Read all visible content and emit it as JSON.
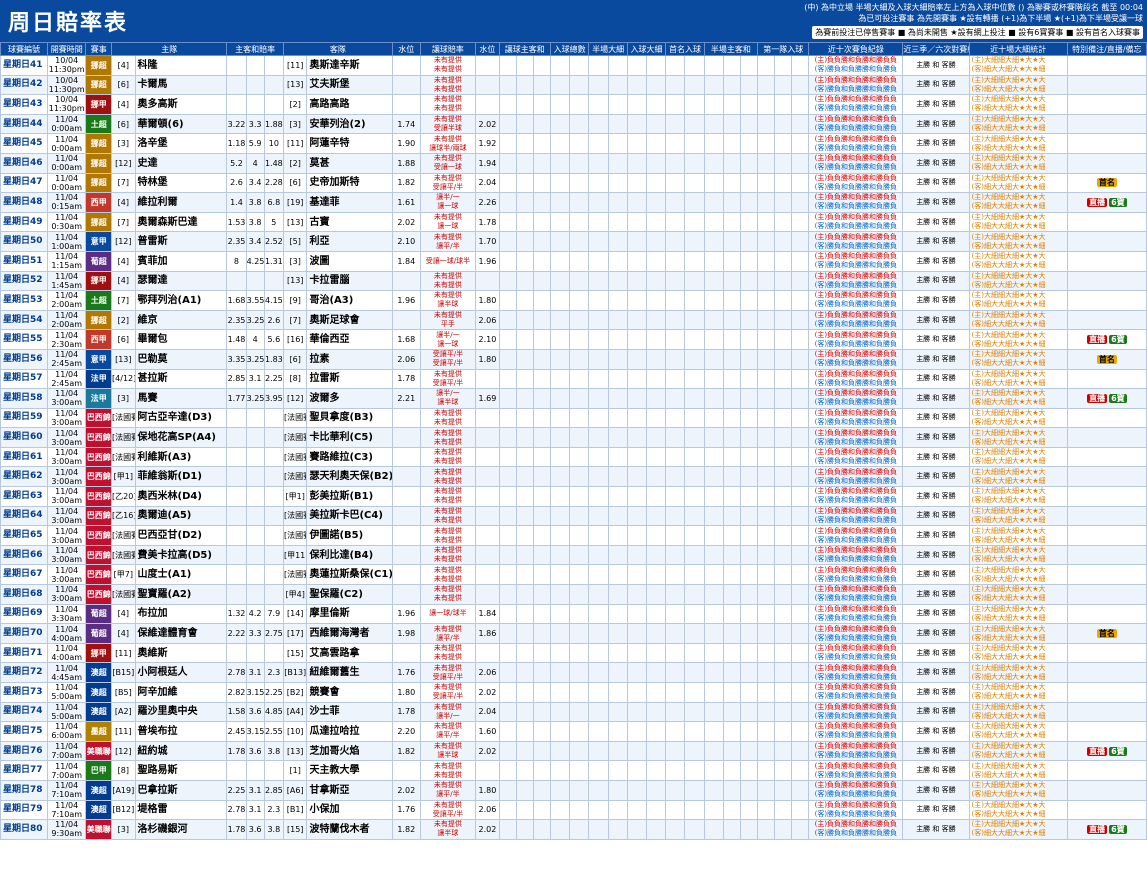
{
  "title": "周日賠率表",
  "legend": {
    "l1": "(中) 為中立場 半場大細及入球大細賠率左上方為入球中位數 () 為聯賽或杯賽階段名 截至 00:04",
    "l2": "為已可投注賽事 為先開賽事 ★設有轉播 (+1)為下半場 ★(+1)為下半場受讓一球",
    "l3": "為賽前投注已停售賽事 ■ 為尚未開售 ★設有網上投注 ■ 設有6寶賽事 ■ 設有首名入球賽事"
  },
  "headers": {
    "match": "球賽編號",
    "time": "開賽時間",
    "league": "賽事",
    "home_rank": "(排名)",
    "home": "主隊",
    "hda": "主客和賠率",
    "h": "主",
    "d": "和",
    "a": "客",
    "away_rank": "(排名)",
    "away": "客隊",
    "line": "水位",
    "hdc": "讓球",
    "hdcodds": "讓球賠率",
    "water": "水位",
    "hhad": "讓球主客和",
    "ttg": "入球總數",
    "hft": "半場大細",
    "ou": "入球大細",
    "fg": "首名入球",
    "hdcwin": "半場主客和",
    "first": "第一隊入球",
    "form": "近十次賽負紀錄",
    "rec": "近三季／六次對賽統計",
    "stars": "近十場大細統計",
    "notes": "特別備注/直播/備忘"
  },
  "rows": [
    {
      "id": "星期日41",
      "date": "10/04",
      "time": "11:30pm",
      "lg": "挪超",
      "lgc": "#b07800",
      "hr": "[4]",
      "home": "科隆",
      "h": "",
      "d": "",
      "a": "",
      "ar": "[11]",
      "away": "奧斯達辛斯",
      "line": "",
      "hdc": "未有提供",
      "hdc2": "未有提供",
      "w": ""
    },
    {
      "id": "星期日42",
      "date": "10/04",
      "time": "11:30pm",
      "lg": "挪超",
      "lgc": "#b07800",
      "hr": "[6]",
      "home": "卡爾馬",
      "h": "",
      "d": "",
      "a": "",
      "ar": "[13]",
      "away": "艾夫斯堡",
      "line": "",
      "hdc": "未有提供",
      "hdc2": "未有提供",
      "w": ""
    },
    {
      "id": "星期日43",
      "date": "10/04",
      "time": "11:30pm",
      "lg": "挪甲",
      "lgc": "#a01010",
      "hr": "[4]",
      "home": "奧多高斯",
      "h": "",
      "d": "",
      "a": "",
      "ar": "[2]",
      "away": "高路高路",
      "line": "",
      "hdc": "未有提供",
      "hdc2": "未有提供",
      "w": ""
    },
    {
      "id": "星期日44",
      "date": "11/04",
      "time": "0:00am",
      "lg": "土超",
      "lgc": "#1a7a1a",
      "hr": "[6]",
      "home": "華爾頓(6)",
      "h": "3.22",
      "d": "3.3",
      "a": "1.88",
      "ar": "[3]",
      "away": "安華列治(2)",
      "line": "1.74",
      "hdc": "未有提供",
      "hdc2": "受讓半球",
      "w": "2.02"
    },
    {
      "id": "星期日45",
      "date": "11/04",
      "time": "0:00am",
      "lg": "挪超",
      "lgc": "#b07800",
      "hr": "[3]",
      "home": "洛辛堡",
      "h": "1.18",
      "d": "5.9",
      "a": "10",
      "ar": "[11]",
      "away": "阿蓮辛特",
      "line": "1.90",
      "hdc": "未有提供",
      "hdc2": "讓球半/兩球",
      "w": "1.92"
    },
    {
      "id": "星期日46",
      "date": "11/04",
      "time": "0:00am",
      "lg": "挪超",
      "lgc": "#b07800",
      "hr": "[12]",
      "home": "史達",
      "h": "5.2",
      "d": "4",
      "a": "1.48",
      "ar": "[2]",
      "away": "莫甚",
      "line": "1.88",
      "hdc": "未有提供",
      "hdc2": "受讓一球",
      "w": "1.94"
    },
    {
      "id": "星期日47",
      "date": "11/04",
      "time": "0:00am",
      "lg": "挪超",
      "lgc": "#b07800",
      "hr": "[7]",
      "home": "特林堡",
      "h": "2.6",
      "d": "3.4",
      "a": "2.28",
      "ar": "[6]",
      "away": "史帝加斯特",
      "line": "1.82",
      "hdc": "未有提供",
      "hdc2": "受讓平/半",
      "w": "2.04"
    },
    {
      "id": "星期日48",
      "date": "11/04",
      "time": "0:15am",
      "lg": "西甲",
      "lgc": "#c0392b",
      "hr": "[4]",
      "home": "維拉利爾",
      "h": "1.4",
      "d": "3.8",
      "a": "6.8",
      "ar": "[19]",
      "away": "基達菲",
      "line": "1.61",
      "hdc": "讓半/一",
      "hdc2": "讓一球",
      "w": "2.26"
    },
    {
      "id": "星期日49",
      "date": "11/04",
      "time": "0:30am",
      "lg": "挪超",
      "lgc": "#b07800",
      "hr": "[7]",
      "home": "奧爾森斯巴達",
      "h": "1.53",
      "d": "3.8",
      "a": "5",
      "ar": "[13]",
      "away": "古寶",
      "line": "2.02",
      "hdc": "未有提供",
      "hdc2": "讓一球",
      "w": "1.78"
    },
    {
      "id": "星期日50",
      "date": "11/04",
      "time": "1:00am",
      "lg": "意甲",
      "lgc": "#0a4a9e",
      "hr": "[12]",
      "home": "普雷斯",
      "h": "2.35",
      "d": "3.4",
      "a": "2.52",
      "ar": "[5]",
      "away": "利亞",
      "line": "2.10",
      "hdc": "未有提供",
      "hdc2": "讓平/半",
      "w": "1.70"
    },
    {
      "id": "星期日51",
      "date": "11/04",
      "time": "1:15am",
      "lg": "葡超",
      "lgc": "#5a2d82",
      "hr": "[4]",
      "home": "賓菲加",
      "h": "8",
      "d": "4.25",
      "a": "1.31",
      "ar": "[3]",
      "away": "波圖",
      "line": "1.84",
      "hdc": "受讓一球/球半",
      "hdc2": "",
      "w": "1.96"
    },
    {
      "id": "星期日52",
      "date": "11/04",
      "time": "1:45am",
      "lg": "挪甲",
      "lgc": "#a01010",
      "hr": "[4]",
      "home": "瑟爾達",
      "h": "",
      "d": "",
      "a": "",
      "ar": "[13]",
      "away": "卡拉雷腦",
      "line": "",
      "hdc": "未有提供",
      "hdc2": "未有提供",
      "w": ""
    },
    {
      "id": "星期日53",
      "date": "11/04",
      "time": "2:00am",
      "lg": "土超",
      "lgc": "#1a7a1a",
      "hr": "[7]",
      "home": "鄂拜列治(A1)",
      "h": "1.68",
      "d": "3.55",
      "a": "4.15",
      "ar": "[9]",
      "away": "哥治(A3)",
      "line": "1.96",
      "hdc": "未有提供",
      "hdc2": "讓半球",
      "w": "1.80"
    },
    {
      "id": "星期日54",
      "date": "11/04",
      "time": "2:00am",
      "lg": "挪超",
      "lgc": "#b07800",
      "hr": "[2]",
      "home": "維京",
      "h": "2.35",
      "d": "3.25",
      "a": "2.6",
      "ar": "[7]",
      "away": "奧斯足球會",
      "line": "",
      "hdc": "未有提供",
      "hdc2": "平手",
      "w": "2.06"
    },
    {
      "id": "星期日55",
      "date": "11/04",
      "time": "2:30am",
      "lg": "西甲",
      "lgc": "#c0392b",
      "hr": "[6]",
      "home": "畢爾包",
      "h": "1.48",
      "d": "4",
      "a": "5.6",
      "ar": "[16]",
      "away": "華倫西亞",
      "line": "1.68",
      "hdc": "讓半/一",
      "hdc2": "讓一球",
      "w": "2.10"
    },
    {
      "id": "星期日56",
      "date": "11/04",
      "time": "2:45am",
      "lg": "意甲",
      "lgc": "#0a4a9e",
      "hr": "[13]",
      "home": "巴勒莫",
      "h": "3.35",
      "d": "3.25",
      "a": "1.83",
      "ar": "[6]",
      "away": "拉素",
      "line": "2.06",
      "hdc": "受讓平/半",
      "hdc2": "受讓平/半",
      "w": "1.80"
    },
    {
      "id": "星期日57",
      "date": "11/04",
      "time": "2:45am",
      "lg": "法甲",
      "lgc": "#003c8f",
      "hr": "[4/12]",
      "home": "甚拉斯",
      "h": "2.85",
      "d": "3.1",
      "a": "2.25",
      "ar": "[8]",
      "away": "拉雷斯",
      "line": "1.78",
      "hdc": "未有提供",
      "hdc2": "受讓平/半",
      "w": ""
    },
    {
      "id": "星期日58",
      "date": "11/04",
      "time": "3:00am",
      "lg": "法甲",
      "lgc": "#1a7a9e",
      "hr": "[3]",
      "home": "馬賽",
      "h": "1.77",
      "d": "3.25",
      "a": "3.95",
      "ar": "[12]",
      "away": "波爾多",
      "line": "2.21",
      "hdc": "讓半/一",
      "hdc2": "讓半球",
      "w": "1.69"
    },
    {
      "id": "星期日59",
      "date": "11/04",
      "time": "3:00am",
      "lg": "巴西錦",
      "lgc": "#c01030",
      "hr": "[法國賽]",
      "home": "阿古亞辛達(D3)",
      "h": "",
      "d": "",
      "a": "",
      "ar": "[法國賽]",
      "away": "聖貝拿度(B3)",
      "line": "",
      "hdc": "未有提供",
      "hdc2": "未有提供",
      "w": ""
    },
    {
      "id": "星期日60",
      "date": "11/04",
      "time": "3:00am",
      "lg": "巴西錦",
      "lgc": "#c01030",
      "hr": "[法國賽]",
      "home": "保地花高SP(A4)",
      "h": "",
      "d": "",
      "a": "",
      "ar": "[法國賽]",
      "away": "卡比華利(C5)",
      "line": "",
      "hdc": "未有提供",
      "hdc2": "未有提供",
      "w": ""
    },
    {
      "id": "星期日61",
      "date": "11/04",
      "time": "3:00am",
      "lg": "巴西錦",
      "lgc": "#c01030",
      "hr": "[法國賽]",
      "home": "利維斯(A3)",
      "h": "",
      "d": "",
      "a": "",
      "ar": "[法國賽]",
      "away": "賽路維拉(C3)",
      "line": "",
      "hdc": "未有提供",
      "hdc2": "未有提供",
      "w": ""
    },
    {
      "id": "星期日62",
      "date": "11/04",
      "time": "3:00am",
      "lg": "巴西錦",
      "lgc": "#c01030",
      "hr": "[甲1]",
      "home": "菲維翁斯(D1)",
      "h": "",
      "d": "",
      "a": "",
      "ar": "[法國賽]",
      "away": "瑟天利奧天保(B2)",
      "line": "",
      "hdc": "未有提供",
      "hdc2": "未有提供",
      "w": ""
    },
    {
      "id": "星期日63",
      "date": "11/04",
      "time": "3:00am",
      "lg": "巴西錦",
      "lgc": "#c01030",
      "hr": "[乙20]",
      "home": "奧西米林(D4)",
      "h": "",
      "d": "",
      "a": "",
      "ar": "[甲1]",
      "away": "彭美拉斯(B1)",
      "line": "",
      "hdc": "未有提供",
      "hdc2": "未有提供",
      "w": ""
    },
    {
      "id": "星期日64",
      "date": "11/04",
      "time": "3:00am",
      "lg": "巴西錦",
      "lgc": "#c01030",
      "hr": "[乙16]",
      "home": "奧爾迪(A5)",
      "h": "",
      "d": "",
      "a": "",
      "ar": "[法國賽]",
      "away": "美拉斯卡巴(C4)",
      "line": "",
      "hdc": "未有提供",
      "hdc2": "未有提供",
      "w": ""
    },
    {
      "id": "星期日65",
      "date": "11/04",
      "time": "3:00am",
      "lg": "巴西錦",
      "lgc": "#c01030",
      "hr": "[法國賽]",
      "home": "巴西亞甘(D2)",
      "h": "",
      "d": "",
      "a": "",
      "ar": "[法國賽]",
      "away": "伊圖諾(B5)",
      "line": "",
      "hdc": "未有提供",
      "hdc2": "未有提供",
      "w": ""
    },
    {
      "id": "星期日66",
      "date": "11/04",
      "time": "3:00am",
      "lg": "巴西錦",
      "lgc": "#c01030",
      "hr": "[法國賽]",
      "home": "費美卡拉高(D5)",
      "h": "",
      "d": "",
      "a": "",
      "ar": "[甲11]",
      "away": "保利比達(B4)",
      "line": "",
      "hdc": "未有提供",
      "hdc2": "未有提供",
      "w": ""
    },
    {
      "id": "星期日67",
      "date": "11/04",
      "time": "3:00am",
      "lg": "巴西錦",
      "lgc": "#c01030",
      "hr": "[甲7]",
      "home": "山度士(A1)",
      "h": "",
      "d": "",
      "a": "",
      "ar": "[法國賽]",
      "away": "奧蓮拉斯桑保(C1)",
      "line": "",
      "hdc": "未有提供",
      "hdc2": "未有提供",
      "w": ""
    },
    {
      "id": "星期日68",
      "date": "11/04",
      "time": "3:00am",
      "lg": "巴西錦",
      "lgc": "#c01030",
      "hr": "[法國賽]",
      "home": "聖寶羅(A2)",
      "h": "",
      "d": "",
      "a": "",
      "ar": "[甲4]",
      "away": "聖保羅(C2)",
      "line": "",
      "hdc": "未有提供",
      "hdc2": "未有提供",
      "w": ""
    },
    {
      "id": "星期日69",
      "date": "11/04",
      "time": "3:30am",
      "lg": "葡超",
      "lgc": "#5a2d82",
      "hr": "[4]",
      "home": "布拉加",
      "h": "1.32",
      "d": "4.2",
      "a": "7.9",
      "ar": "[14]",
      "away": "摩里倫斯",
      "line": "1.96",
      "hdc": "讓一球/球半",
      "hdc2": "",
      "w": "1.84"
    },
    {
      "id": "星期日70",
      "date": "11/04",
      "time": "4:00am",
      "lg": "葡超",
      "lgc": "#5a2d82",
      "hr": "[4]",
      "home": "保維達體育會",
      "h": "2.22",
      "d": "3.3",
      "a": "2.75",
      "ar": "[17]",
      "away": "西維爾海灣者",
      "line": "1.98",
      "hdc": "未有提供",
      "hdc2": "讓平/半",
      "w": "1.86"
    },
    {
      "id": "星期日71",
      "date": "11/04",
      "time": "4:00am",
      "lg": "挪甲",
      "lgc": "#a01010",
      "hr": "[11]",
      "home": "奧維斯",
      "h": "",
      "d": "",
      "a": "",
      "ar": "[15]",
      "away": "艾高雲路拿",
      "line": "",
      "hdc": "未有提供",
      "hdc2": "未有提供",
      "w": ""
    },
    {
      "id": "星期日72",
      "date": "11/04",
      "time": "4:45am",
      "lg": "澳超",
      "lgc": "#003c8f",
      "hr": "[B15]",
      "home": "小阿根廷人",
      "h": "2.78",
      "d": "3.1",
      "a": "2.3",
      "ar": "[B13]",
      "away": "紐維爾舊生",
      "line": "1.76",
      "hdc": "未有提供",
      "hdc2": "受讓平/半",
      "w": "2.06"
    },
    {
      "id": "星期日73",
      "date": "11/04",
      "time": "5:00am",
      "lg": "澳超",
      "lgc": "#003c8f",
      "hr": "[B5]",
      "home": "阿辛加維",
      "h": "2.82",
      "d": "3.15",
      "a": "2.25",
      "ar": "[B2]",
      "away": "競賽會",
      "line": "1.80",
      "hdc": "未有提供",
      "hdc2": "受讓平/半",
      "w": "2.02"
    },
    {
      "id": "星期日74",
      "date": "11/04",
      "time": "5:00am",
      "lg": "澳超",
      "lgc": "#003c8f",
      "hr": "[A2]",
      "home": "羅沙里奧中央",
      "h": "1.58",
      "d": "3.6",
      "a": "4.85",
      "ar": "[A4]",
      "away": "沙士菲",
      "line": "1.78",
      "hdc": "未有提供",
      "hdc2": "讓半/一",
      "w": "2.04"
    },
    {
      "id": "星期日75",
      "date": "11/04",
      "time": "6:00am",
      "lg": "墨超",
      "lgc": "#b08000",
      "hr": "[11]",
      "home": "普埃布拉",
      "h": "2.45",
      "d": "3.15",
      "a": "2.55",
      "ar": "[10]",
      "away": "瓜達拉哈拉",
      "line": "2.20",
      "hdc": "未有提供",
      "hdc2": "讓平/半",
      "w": "1.60"
    },
    {
      "id": "星期日76",
      "date": "11/04",
      "time": "7:00am",
      "lg": "美職聯",
      "lgc": "#c01030",
      "hr": "[12]",
      "home": "紐約城",
      "h": "1.78",
      "d": "3.6",
      "a": "3.8",
      "ar": "[13]",
      "away": "芝加哥火焰",
      "line": "1.82",
      "hdc": "未有提供",
      "hdc2": "讓半球",
      "w": "2.02"
    },
    {
      "id": "星期日77",
      "date": "11/04",
      "time": "7:00am",
      "lg": "巴甲",
      "lgc": "#1a7a1a",
      "hr": "[8]",
      "home": "聖路易斯",
      "h": "",
      "d": "",
      "a": "",
      "ar": "[1]",
      "away": "天主教大學",
      "line": "",
      "hdc": "未有提供",
      "hdc2": "未有提供",
      "w": ""
    },
    {
      "id": "星期日78",
      "date": "11/04",
      "time": "7:10am",
      "lg": "澳超",
      "lgc": "#003c8f",
      "hr": "[A19]",
      "home": "巴拿拉斯",
      "h": "2.25",
      "d": "3.1",
      "a": "2.85",
      "ar": "[A6]",
      "away": "甘拿斯亞",
      "line": "2.02",
      "hdc": "未有提供",
      "hdc2": "讓平/半",
      "w": "1.80"
    },
    {
      "id": "星期日79",
      "date": "11/04",
      "time": "7:10am",
      "lg": "澳超",
      "lgc": "#003c8f",
      "hr": "[B12]",
      "home": "堤格雷",
      "h": "2.78",
      "d": "3.1",
      "a": "2.3",
      "ar": "[B1]",
      "away": "小保加",
      "line": "1.76",
      "hdc": "未有提供",
      "hdc2": "受讓平/半",
      "w": "2.06"
    },
    {
      "id": "星期日80",
      "date": "11/04",
      "time": "9:30am",
      "lg": "美職聯",
      "lgc": "#c01030",
      "hr": "[3]",
      "home": "洛杉磯銀河",
      "h": "1.78",
      "d": "3.6",
      "a": "3.8",
      "ar": "[15]",
      "away": "波特蘭伐木者",
      "line": "1.82",
      "hdc": "未有提供",
      "hdc2": "讓半球",
      "w": "2.02"
    }
  ],
  "form_h": "(主)負負勝和負勝和勝負負",
  "form_a": "(客)勝負和負勝勝和負勝負",
  "rec_top": [
    "主勝",
    "和",
    "客勝"
  ],
  "stars_h": "(主)大細細大細★大★大",
  "stars_a": "(客)細大大細大★大★細",
  "icons": {
    "tv": "直播",
    "six": "6寶",
    "first": "首名"
  }
}
